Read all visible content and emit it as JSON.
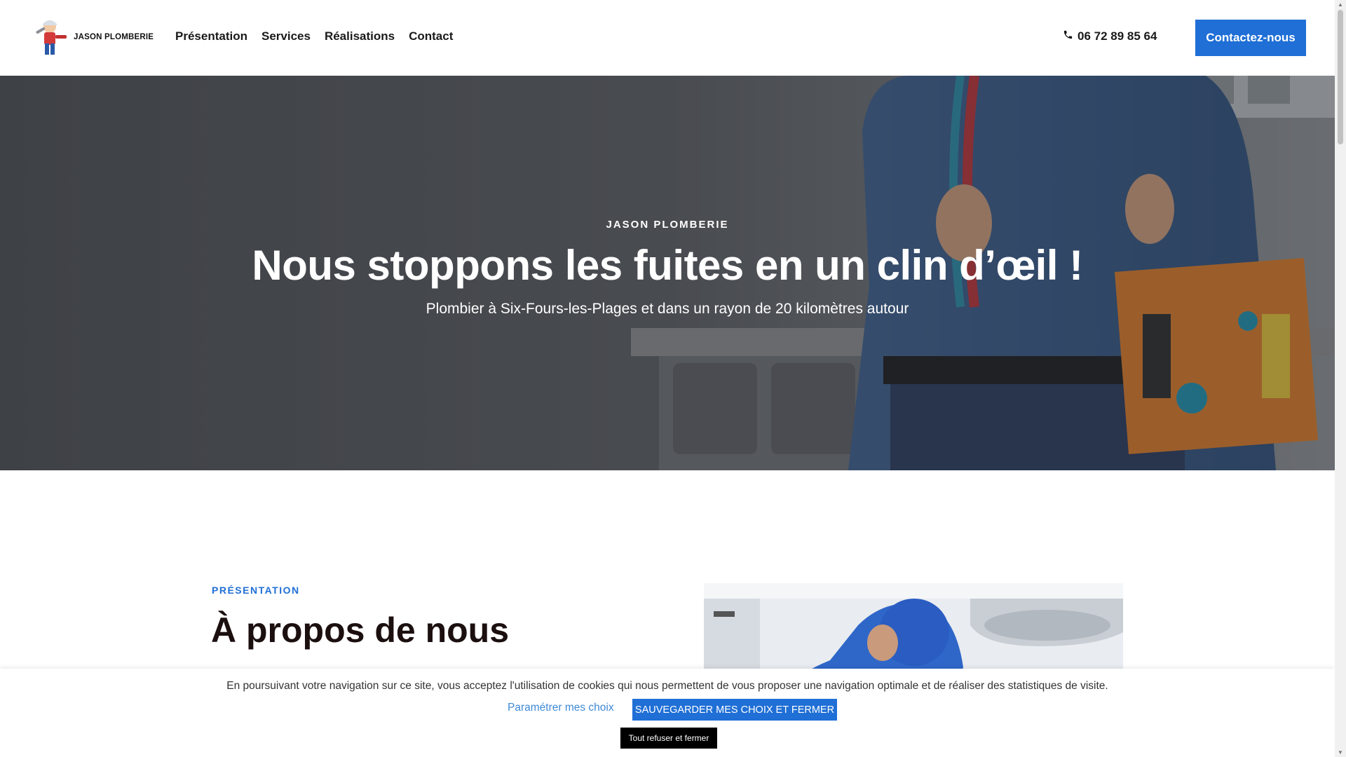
{
  "header": {
    "logo_text": "JASON PLOMBERIE",
    "nav": [
      "Présentation",
      "Services",
      "Réalisations",
      "Contact"
    ],
    "phone": "06 72 89 85 64",
    "cta_label": "Contactez-nous"
  },
  "hero": {
    "eyebrow": "JASON PLOMBERIE",
    "title": "Nous stoppons les fuites en un clin d’œil !",
    "subtitle": "Plombier à Six-Fours-les-Plages et dans un rayon de 20 kilomètres autour"
  },
  "about": {
    "eyebrow": "PRÉSENTATION",
    "title": "À propos de nous"
  },
  "cookie": {
    "text": "En poursuivant votre navigation sur ce site, vous acceptez l'utilisation de cookies qui nous permettent de vous proposer une navigation optimale et de réaliser des statistiques de visite.",
    "settings_link": "Paramétrer mes choix",
    "save_button": "SAUVEGARDER MES CHOIX ET FERMER",
    "refuse_button": "Tout refuser et fermer"
  },
  "colors": {
    "accent": "#1f6fd6",
    "heading_dark": "#1c0f0f"
  }
}
